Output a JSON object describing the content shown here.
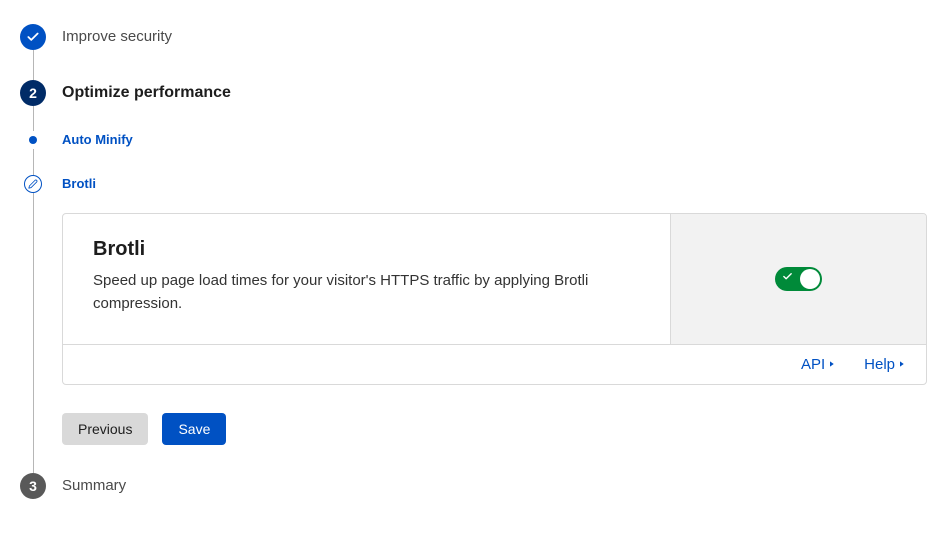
{
  "steps": {
    "s1": {
      "title": "Improve security"
    },
    "s2": {
      "title": "Optimize performance",
      "sub": {
        "auto_minify": "Auto Minify",
        "brotli": "Brotli"
      }
    },
    "s3": {
      "title": "Summary"
    }
  },
  "card": {
    "title": "Brotli",
    "description": "Speed up page load times for your visitor's HTTPS traffic by applying Brotli compression.",
    "links": {
      "api": "API",
      "help": "Help"
    }
  },
  "actions": {
    "previous": "Previous",
    "save": "Save"
  }
}
